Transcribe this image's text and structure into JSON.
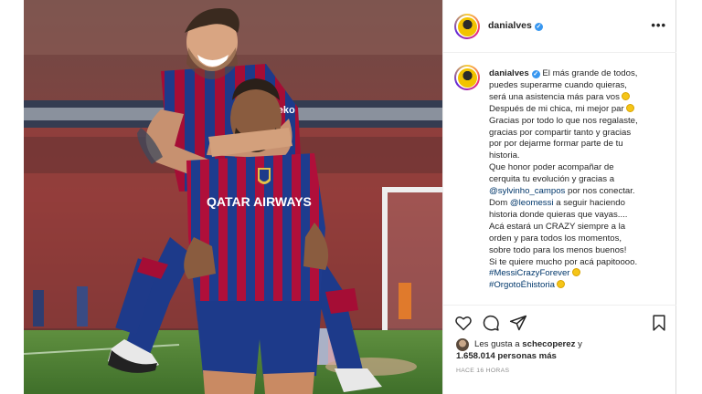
{
  "post": {
    "username": "danialves",
    "more_label": "•••",
    "caption_lines": [
      "El más grande de todos,",
      "puedes superarme cuando quieras,",
      "será una asistencia más para vos",
      "Después de mi chica, mi mejor par",
      "Gracias por todo lo que nos regalaste,",
      "gracias por compartir tanto y gracias",
      "por por dejarme formar parte de tu",
      "historia.",
      "Que honor poder acompañar de",
      "cerquita tu evolución y gracias a",
      "@sylvinho_campos por nos conectar.",
      "Dom @leomessi a seguir haciendo",
      "historia donde quieras que vayas....",
      "Acá estará un CRAZY siempre a la",
      "orden y para todos los momentos,",
      "sobre todo para los menos buenos!",
      "Si te quiere mucho por acá papitoooo.",
      "#MessiCrazyForever",
      "#OrgotoÉhistoria"
    ],
    "mention_1": "@sylvinho_campos",
    "mention_2": "@leomessi",
    "likes_prefix": "Les gusta a",
    "likes_user": "schecoperez",
    "likes_suffix": "y",
    "likes_count": "1.658.014",
    "likes_others": "personas más",
    "time_ago": "HACE 16 HORAS"
  },
  "photo": {
    "sponsor_text": "QATAR AIRWAYS",
    "sleeve_text": "beko"
  },
  "colors": {
    "accent_blue": "#3897f0",
    "link_blue": "#00376b",
    "text_dark": "#262626",
    "text_muted": "#8e8e8e",
    "jersey_blue": "#1d3a8a",
    "jersey_red": "#a50d35"
  },
  "icons": [
    "heart-icon",
    "comment-icon",
    "share-icon",
    "bookmark-icon",
    "verified-icon",
    "more-options-icon"
  ]
}
